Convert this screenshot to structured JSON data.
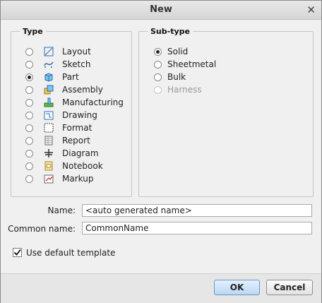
{
  "dialog": {
    "title": "New"
  },
  "type_group": {
    "legend": "Type",
    "items": [
      {
        "label": "Layout",
        "selected": false,
        "icon": "layout-icon"
      },
      {
        "label": "Sketch",
        "selected": false,
        "icon": "sketch-icon"
      },
      {
        "label": "Part",
        "selected": true,
        "icon": "part-icon"
      },
      {
        "label": "Assembly",
        "selected": false,
        "icon": "assembly-icon"
      },
      {
        "label": "Manufacturing",
        "selected": false,
        "icon": "manufacturing-icon"
      },
      {
        "label": "Drawing",
        "selected": false,
        "icon": "drawing-icon"
      },
      {
        "label": "Format",
        "selected": false,
        "icon": "format-icon"
      },
      {
        "label": "Report",
        "selected": false,
        "icon": "report-icon"
      },
      {
        "label": "Diagram",
        "selected": false,
        "icon": "diagram-icon"
      },
      {
        "label": "Notebook",
        "selected": false,
        "icon": "notebook-icon"
      },
      {
        "label": "Markup",
        "selected": false,
        "icon": "markup-icon"
      }
    ]
  },
  "subtype_group": {
    "legend": "Sub-type",
    "items": [
      {
        "label": "Solid",
        "selected": true,
        "disabled": false
      },
      {
        "label": "Sheetmetal",
        "selected": false,
        "disabled": false
      },
      {
        "label": "Bulk",
        "selected": false,
        "disabled": false
      },
      {
        "label": "Harness",
        "selected": false,
        "disabled": true
      }
    ]
  },
  "form": {
    "name_label": "Name:",
    "name_value": "<auto generated name>",
    "common_name_label": "Common name:",
    "common_name_value": "CommonName",
    "use_default_template_label": "Use default template",
    "use_default_template_checked": true
  },
  "buttons": {
    "ok": "OK",
    "cancel": "Cancel"
  }
}
